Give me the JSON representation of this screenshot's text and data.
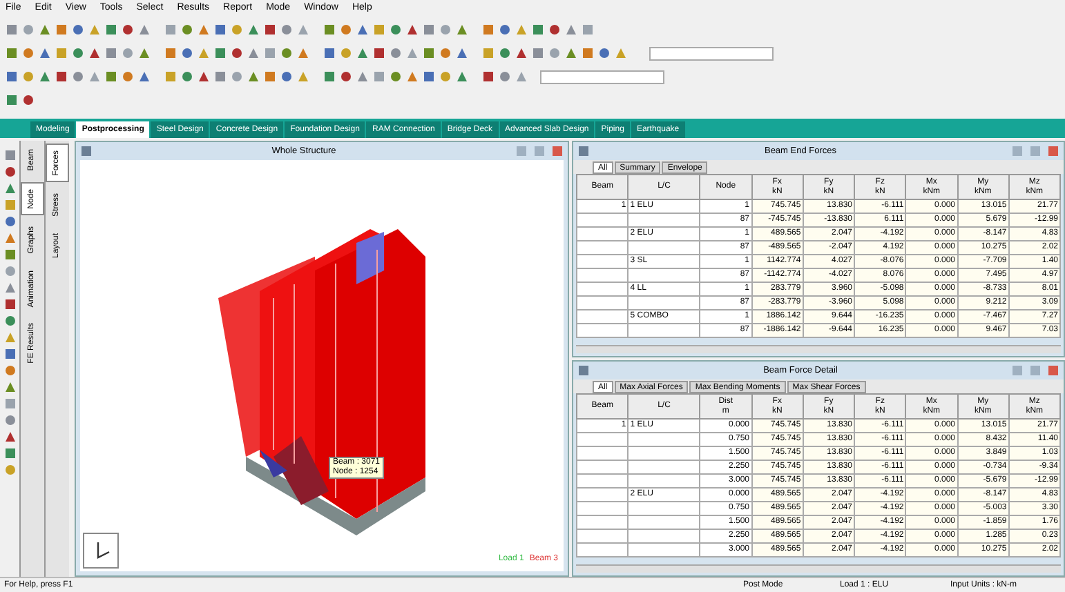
{
  "menu": [
    "File",
    "Edit",
    "View",
    "Tools",
    "Select",
    "Results",
    "Report",
    "Mode",
    "Window",
    "Help"
  ],
  "mode_tabs": [
    {
      "label": "Modeling",
      "selected": false
    },
    {
      "label": "Postprocessing",
      "selected": true
    },
    {
      "label": "Steel Design",
      "selected": false
    },
    {
      "label": "Concrete Design",
      "selected": false
    },
    {
      "label": "Foundation Design",
      "selected": false
    },
    {
      "label": "RAM Connection",
      "selected": false
    },
    {
      "label": "Bridge Deck",
      "selected": false
    },
    {
      "label": "Advanced Slab Design",
      "selected": false
    },
    {
      "label": "Piping",
      "selected": false
    },
    {
      "label": "Earthquake",
      "selected": false
    }
  ],
  "side_tabs": [
    {
      "label": "Beam",
      "selected": false
    },
    {
      "label": "Node",
      "selected": true
    },
    {
      "label": "Graphs",
      "selected": false
    },
    {
      "label": "Animation",
      "selected": false
    },
    {
      "label": "FE Results",
      "selected": false
    }
  ],
  "side_tabs_2": [
    {
      "label": "Forces",
      "selected": true
    },
    {
      "label": "Stress",
      "selected": false
    },
    {
      "label": "Layout",
      "selected": false
    }
  ],
  "view": {
    "title": "Whole Structure",
    "tooltip": [
      "Beam : 3071",
      "Node : 1254"
    ],
    "legend": [
      "Load 1",
      "Beam 3"
    ]
  },
  "tables": [
    {
      "title": "Beam End Forces",
      "sheet_tabs": [
        {
          "label": "All",
          "selected": true
        },
        {
          "label": "Summary",
          "selected": false
        },
        {
          "label": "Envelope",
          "selected": false
        }
      ],
      "columns": [
        {
          "name": "Beam"
        },
        {
          "name": "L/C"
        },
        {
          "name": "Node"
        },
        {
          "name": "Fx",
          "unit": "kN"
        },
        {
          "name": "Fy",
          "unit": "kN"
        },
        {
          "name": "Fz",
          "unit": "kN"
        },
        {
          "name": "Mx",
          "unit": "kNm"
        },
        {
          "name": "My",
          "unit": "kNm"
        },
        {
          "name": "Mz",
          "unit": "kNm"
        }
      ],
      "rows": [
        [
          "1",
          "1 ELU",
          "1",
          "745.745",
          "13.830",
          "-6.111",
          "0.000",
          "13.015",
          "21.77"
        ],
        [
          "",
          "",
          "87",
          "-745.745",
          "-13.830",
          "6.111",
          "0.000",
          "5.679",
          "-12.99"
        ],
        [
          "",
          "2 ELU",
          "1",
          "489.565",
          "2.047",
          "-4.192",
          "0.000",
          "-8.147",
          "4.83"
        ],
        [
          "",
          "",
          "87",
          "-489.565",
          "-2.047",
          "4.192",
          "0.000",
          "10.275",
          "2.02"
        ],
        [
          "",
          "3 SL",
          "1",
          "1142.774",
          "4.027",
          "-8.076",
          "0.000",
          "-7.709",
          "1.40"
        ],
        [
          "",
          "",
          "87",
          "-1142.774",
          "-4.027",
          "8.076",
          "0.000",
          "7.495",
          "4.97"
        ],
        [
          "",
          "4 LL",
          "1",
          "283.779",
          "3.960",
          "-5.098",
          "0.000",
          "-8.733",
          "8.01"
        ],
        [
          "",
          "",
          "87",
          "-283.779",
          "-3.960",
          "5.098",
          "0.000",
          "9.212",
          "3.09"
        ],
        [
          "",
          "5 COMBO",
          "1",
          "1886.142",
          "9.644",
          "-16.235",
          "0.000",
          "-7.467",
          "7.27"
        ],
        [
          "",
          "",
          "87",
          "-1886.142",
          "-9.644",
          "16.235",
          "0.000",
          "9.467",
          "7.03"
        ]
      ]
    },
    {
      "title": "Beam Force Detail",
      "sheet_tabs": [
        {
          "label": "All",
          "selected": true
        },
        {
          "label": "Max Axial Forces",
          "selected": false
        },
        {
          "label": "Max Bending Moments",
          "selected": false
        },
        {
          "label": "Max Shear Forces",
          "selected": false
        }
      ],
      "columns": [
        {
          "name": "Beam"
        },
        {
          "name": "L/C"
        },
        {
          "name": "Dist",
          "unit": "m"
        },
        {
          "name": "Fx",
          "unit": "kN"
        },
        {
          "name": "Fy",
          "unit": "kN"
        },
        {
          "name": "Fz",
          "unit": "kN"
        },
        {
          "name": "Mx",
          "unit": "kNm"
        },
        {
          "name": "My",
          "unit": "kNm"
        },
        {
          "name": "Mz",
          "unit": "kNm"
        }
      ],
      "rows": [
        [
          "1",
          "1 ELU",
          "0.000",
          "745.745",
          "13.830",
          "-6.111",
          "0.000",
          "13.015",
          "21.77"
        ],
        [
          "",
          "",
          "0.750",
          "745.745",
          "13.830",
          "-6.111",
          "0.000",
          "8.432",
          "11.40"
        ],
        [
          "",
          "",
          "1.500",
          "745.745",
          "13.830",
          "-6.111",
          "0.000",
          "3.849",
          "1.03"
        ],
        [
          "",
          "",
          "2.250",
          "745.745",
          "13.830",
          "-6.111",
          "0.000",
          "-0.734",
          "-9.34"
        ],
        [
          "",
          "",
          "3.000",
          "745.745",
          "13.830",
          "-6.111",
          "0.000",
          "-5.679",
          "-12.99"
        ],
        [
          "",
          "2 ELU",
          "0.000",
          "489.565",
          "2.047",
          "-4.192",
          "0.000",
          "-8.147",
          "4.83"
        ],
        [
          "",
          "",
          "0.750",
          "489.565",
          "2.047",
          "-4.192",
          "0.000",
          "-5.003",
          "3.30"
        ],
        [
          "",
          "",
          "1.500",
          "489.565",
          "2.047",
          "-4.192",
          "0.000",
          "-1.859",
          "1.76"
        ],
        [
          "",
          "",
          "2.250",
          "489.565",
          "2.047",
          "-4.192",
          "0.000",
          "1.285",
          "0.23"
        ],
        [
          "",
          "",
          "3.000",
          "489.565",
          "2.047",
          "-4.192",
          "0.000",
          "10.275",
          "2.02"
        ]
      ]
    }
  ],
  "status_bar": [
    "For Help, press F1",
    "Post Mode",
    "Load 1 : ELU",
    "Input Units : kN-m"
  ]
}
